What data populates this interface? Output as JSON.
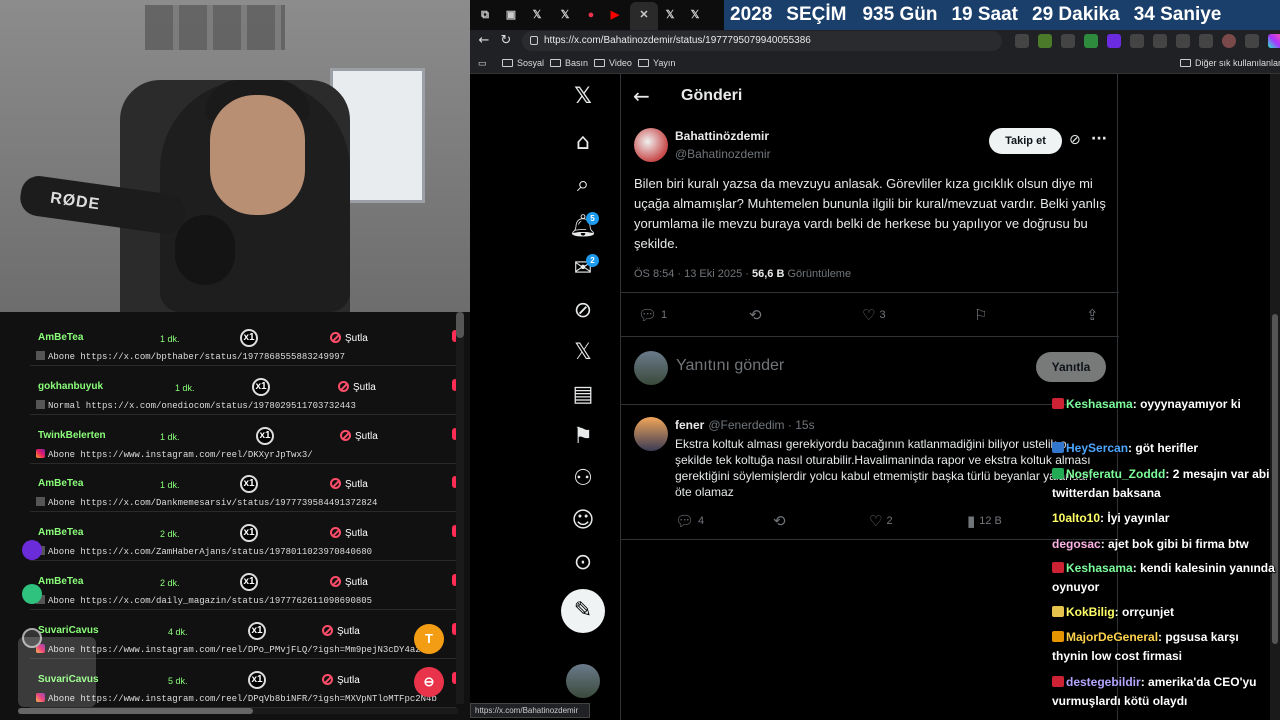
{
  "browser": {
    "countdown": {
      "year": "2028",
      "label": "SEÇİM",
      "days": "935 Gün",
      "hours": "19 Saat",
      "minutes": "29 Dakika",
      "seconds": "34 Saniye"
    },
    "url": "https://x.com/Bahatinozdemir/status/1977795079940055386",
    "bookmarks": [
      "Sosyal",
      "Basın",
      "Video",
      "Yayın"
    ],
    "bookmarks_other": "Diğer sık kullanılanlar",
    "status_url": "https://x.com/Bahatinozdemir"
  },
  "x": {
    "header_title": "Gönderi",
    "badges": {
      "notifications": "5",
      "messages": "2"
    },
    "tweet": {
      "name": "Bahattinözdemir",
      "handle": "@Bahatinozdemir",
      "follow_label": "Takip et",
      "text": "Bilen biri kuralı yazsa da mevzuyu anlasak. Görevliler kıza gıcıklık olsun diye mi uçağa almamışlar? Muhtemelen bununla ilgili bir kural/mevzuat vardır. Belki yanlış yorumlama ile mevzu buraya vardı belki de herkese bu yapılıyor ve doğrusu bu şekilde.",
      "timestamp": "ÖS 8:54 · 13 Eki 2025 · ",
      "views": "56,6 B",
      "views_label": "Görüntüleme",
      "replies": "1",
      "likes": "3"
    },
    "reply_box": {
      "placeholder": "Yanıtını gönder",
      "button": "Yanıtla"
    },
    "comment": {
      "name": "fener",
      "handle": "@Fenerdedim · 15s",
      "text": "Ekstra koltuk alması gerekiyordu bacağının katlanmadiğini biliyor ustelik o şekilde tek koltuğa nasıl oturabilir.Havalimaninda rapor ve ekstra koltuk alması gerektiğini söylemişlerdir yolcu kabul etmemiştir başka türlü beyanlar yalandan öte olamaz",
      "replies": "4",
      "likes": "2",
      "views": "12 B"
    }
  },
  "queue": {
    "items": [
      {
        "user": "AmBeTea",
        "time": "1 dk.",
        "count": "x1",
        "action": "Şutla",
        "source": "x",
        "link": "Abone https://x.com/bpthaber/status/1977868555883249997"
      },
      {
        "user": "gokhanbuyuk",
        "time": "1 dk.",
        "count": "x1",
        "action": "Şutla",
        "source": "x",
        "link": "Normal https://x.com/onediocom/status/1978029511703732443"
      },
      {
        "user": "TwinkBelerten",
        "time": "1 dk.",
        "count": "x1",
        "action": "Şutla",
        "source": "ig",
        "link": "Abone https://www.instagram.com/reel/DKXyrJpTwx3/"
      },
      {
        "user": "AmBeTea",
        "time": "1 dk.",
        "count": "x1",
        "action": "Şutla",
        "source": "x",
        "link": "Abone https://x.com/Dankmemesarsiv/status/1977739584491372824"
      },
      {
        "user": "AmBeTea",
        "time": "2 dk.",
        "count": "x1",
        "action": "Şutla",
        "source": "x",
        "link": "Abone https://x.com/ZamHaberAjans/status/1978011023970840680"
      },
      {
        "user": "AmBeTea",
        "time": "2 dk.",
        "count": "x1",
        "action": "Şutla",
        "source": "x",
        "link": "Abone https://x.com/daily_magazin/status/1977762611098690805"
      },
      {
        "user": "SuvariCavus",
        "time": "4 dk.",
        "count": "x1",
        "action": "Şutla",
        "source": "ig",
        "link": "Abone https://www.instagram.com/reel/DPo_PMvjFLQ/?igsh=Mm9pejN3cDY4azI2"
      },
      {
        "user": "SuvariCavus",
        "time": "5 dk.",
        "count": "x1",
        "action": "Şutla",
        "source": "ig",
        "link": "Abone https://www.instagram.com/reel/DPqVb8biNFR/?igsh=MXVpNTloMTFpc2N4b"
      }
    ],
    "fab_letter": "T"
  },
  "webcam": {
    "mic_label": "RØDE"
  },
  "chat": [
    {
      "user": "Keshasama",
      "text": "oyyynayamıyor ki",
      "color": "#7CFC9A",
      "badge": "#cc2233"
    },
    {
      "user": "HeySercan",
      "text": "göt herifler",
      "color": "#4da6ff",
      "badge": "#3377cc"
    },
    {
      "user": "Nosferatu_Zoddd",
      "text": "2 mesajın var abi twitterdan baksana",
      "color": "#7CFC9A",
      "badge": "#22aa55"
    },
    {
      "user": "10alto10",
      "text": "İyi yayınlar",
      "color": "#ffff66",
      "badge": ""
    },
    {
      "user": "degosac",
      "text": "ajet bok gibi bi firma btw",
      "color": "#ffb3e6",
      "badge": ""
    },
    {
      "user": "Keshasama",
      "text": "kendi kalesinin yanında oynuyor",
      "color": "#7CFC9A",
      "badge": "#cc2233"
    },
    {
      "user": "KokBilig",
      "text": "orrçunjet",
      "color": "#ffff66",
      "badge": "#e6c34d"
    },
    {
      "user": "MajorDeGeneral",
      "text": "pgsusa karşı thynin low cost firmasi",
      "color": "#ffd24d",
      "badge": "#e69500"
    },
    {
      "user": "destegebildir",
      "text": "amerika'da CEO'yu vurmuşlardı kötü olaydı",
      "color": "#b3a6ff",
      "badge": "#cc2233"
    }
  ]
}
